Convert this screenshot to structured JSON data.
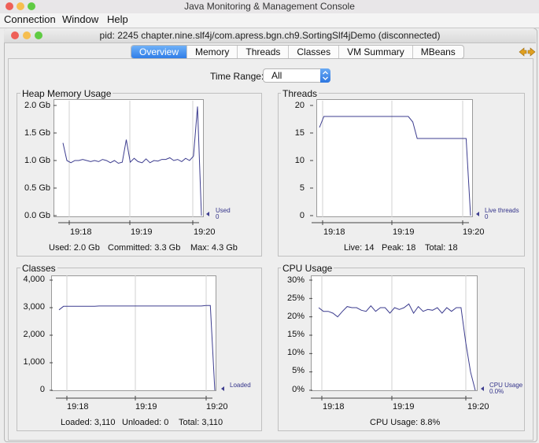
{
  "window": {
    "title": "Java Monitoring & Management Console",
    "traffic_colors": [
      "#ee5f57",
      "#f6be4f",
      "#5fcb43"
    ]
  },
  "menubar": {
    "items": [
      "Connection",
      "Window",
      "Help"
    ]
  },
  "inner_window": {
    "title": "pid: 2245 chapter.nine.slf4j/com.apress.bgn.ch9.SortingSlf4jDemo (disconnected)"
  },
  "tabs": {
    "items": [
      "Overview",
      "Memory",
      "Threads",
      "Classes",
      "VM Summary",
      "MBeans"
    ],
    "active": "Overview"
  },
  "time_range": {
    "label": "Time Range:",
    "value": "All"
  },
  "colors": {
    "series": "#3d3d8f",
    "accent": "#2f7de8"
  },
  "panels": {
    "heap": {
      "title": "Heap Memory Usage",
      "stats": {
        "used": "Used: 2.0 Gb",
        "committed": "Committed: 3.3 Gb",
        "max": "Max: 4.3 Gb"
      }
    },
    "threads": {
      "title": "Threads",
      "stats": {
        "live": "Live: 14",
        "peak": "Peak: 18",
        "total": "Total: 18"
      }
    },
    "classes": {
      "title": "Classes",
      "stats": {
        "loaded": "Loaded: 3,110",
        "unloaded": "Unloaded: 0",
        "total": "Total: 3,110"
      }
    },
    "cpu": {
      "title": "CPU Usage",
      "stats": {
        "usage": "CPU Usage: 8.8%"
      }
    }
  },
  "chart_data": [
    {
      "id": "heap",
      "type": "line",
      "ylim": [
        0,
        2.0
      ],
      "yticks": [
        2.0,
        1.5,
        1.0,
        0.5,
        0.0
      ],
      "ytick_labels": [
        "2.0 Gb",
        "1.5 Gb",
        "1.0 Gb",
        "0.5 Gb",
        "0.0 Gb"
      ],
      "xticks": [
        "19:18",
        "19:19",
        "19:20"
      ],
      "series": [
        {
          "name": "Used",
          "legend_value": "0",
          "values": [
            1.32,
            1.0,
            0.96,
            1.0,
            1.0,
            1.02,
            1.0,
            0.98,
            1.0,
            0.98,
            1.02,
            1.0,
            0.96,
            1.0,
            0.95,
            0.97,
            1.38,
            0.97,
            1.04,
            0.98,
            0.96,
            1.03,
            0.96,
            1.0,
            0.99,
            1.02,
            1.02,
            1.05,
            1.0,
            1.02,
            0.98,
            1.04,
            1.0,
            1.08,
            1.98,
            0.0
          ]
        }
      ]
    },
    {
      "id": "threads",
      "type": "line",
      "ylim": [
        0,
        20
      ],
      "yticks": [
        20,
        15,
        10,
        5,
        0
      ],
      "ytick_labels": [
        "20",
        "15",
        "10",
        "5",
        "0"
      ],
      "xticks": [
        "19:18",
        "19:19",
        "19:20"
      ],
      "series": [
        {
          "name": "Live threads",
          "legend_value": "0",
          "values": [
            16,
            18,
            18,
            18,
            18,
            18,
            18,
            18,
            18,
            18,
            18,
            18,
            18,
            18,
            18,
            18,
            18,
            18,
            18,
            18,
            18,
            17,
            14,
            14,
            14,
            14,
            14,
            14,
            14,
            14,
            14,
            14,
            14,
            14,
            0
          ]
        }
      ]
    },
    {
      "id": "classes",
      "type": "line",
      "ylim": [
        0,
        4000
      ],
      "yticks": [
        4000,
        3000,
        2000,
        1000,
        0
      ],
      "ytick_labels": [
        "4,000",
        "3,000",
        "2,000",
        "1,000",
        "0"
      ],
      "xticks": [
        "19:18",
        "19:19",
        "19:20"
      ],
      "series": [
        {
          "name": "Loaded",
          "legend_value": "",
          "values": [
            2920,
            3050,
            3050,
            3050,
            3050,
            3050,
            3050,
            3050,
            3050,
            3060,
            3060,
            3060,
            3060,
            3060,
            3060,
            3060,
            3060,
            3060,
            3060,
            3060,
            3060,
            3060,
            3060,
            3060,
            3060,
            3060,
            3060,
            3060,
            3060,
            3060,
            3060,
            3060,
            3060,
            3080,
            3080,
            0
          ]
        }
      ]
    },
    {
      "id": "cpu",
      "type": "line",
      "ylim": [
        0,
        30
      ],
      "yticks": [
        30,
        25,
        20,
        15,
        10,
        5,
        0
      ],
      "ytick_labels": [
        "30%",
        "25%",
        "20%",
        "15%",
        "10%",
        "5%",
        "0%"
      ],
      "xticks": [
        "19:18",
        "19:19",
        "19:20"
      ],
      "series": [
        {
          "name": "CPU Usage",
          "legend_value": "0.0%",
          "values": [
            22.5,
            21.5,
            21.5,
            21.0,
            20.0,
            21.5,
            22.8,
            22.5,
            22.5,
            21.8,
            21.5,
            23.0,
            21.5,
            22.5,
            22.5,
            21.0,
            22.5,
            22.0,
            22.5,
            23.5,
            21.0,
            22.8,
            21.5,
            22.0,
            21.8,
            22.5,
            21.0,
            22.5,
            21.5,
            22.5,
            22.5,
            13.0,
            5.0,
            0.0
          ]
        }
      ]
    }
  ]
}
